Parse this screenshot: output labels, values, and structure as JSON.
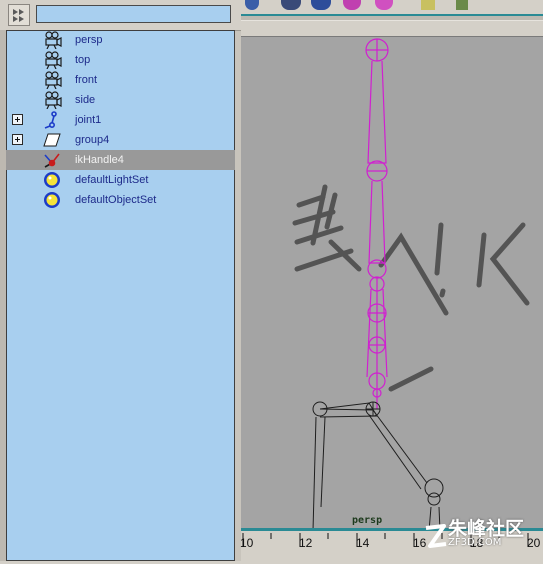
{
  "outliner": {
    "filter_value": "",
    "items": [
      {
        "label": "persp",
        "icon": "camera-icon",
        "expandable": false,
        "selected": false
      },
      {
        "label": "top",
        "icon": "camera-icon",
        "expandable": false,
        "selected": false
      },
      {
        "label": "front",
        "icon": "camera-icon",
        "expandable": false,
        "selected": false
      },
      {
        "label": "side",
        "icon": "camera-icon",
        "expandable": false,
        "selected": false
      },
      {
        "label": "joint1",
        "icon": "joint-icon",
        "expandable": true,
        "selected": false
      },
      {
        "label": "group4",
        "icon": "group-icon",
        "expandable": true,
        "selected": false
      },
      {
        "label": "ikHandle4",
        "icon": "ik-handle-icon",
        "expandable": false,
        "selected": true
      },
      {
        "label": "defaultLightSet",
        "icon": "set-icon",
        "expandable": false,
        "selected": false
      },
      {
        "label": "defaultObjectSet",
        "icon": "set-icon",
        "expandable": false,
        "selected": false
      }
    ]
  },
  "viewport": {
    "camera_label": "persp",
    "annotation_text": "线 IK"
  },
  "timeline": {
    "ticks": [
      "10",
      "12",
      "14",
      "16",
      "18",
      "20"
    ]
  },
  "watermark": {
    "text": "朱峰社区",
    "url": "ZF3D.COM"
  },
  "colors": {
    "outliner_bg": "#a8cfef",
    "selected_row": "#999999",
    "label_text": "#1d2a8a",
    "skeleton": "#d020d0",
    "viewport_bg": "#a4a4a4",
    "accent": "#2a8a94"
  }
}
